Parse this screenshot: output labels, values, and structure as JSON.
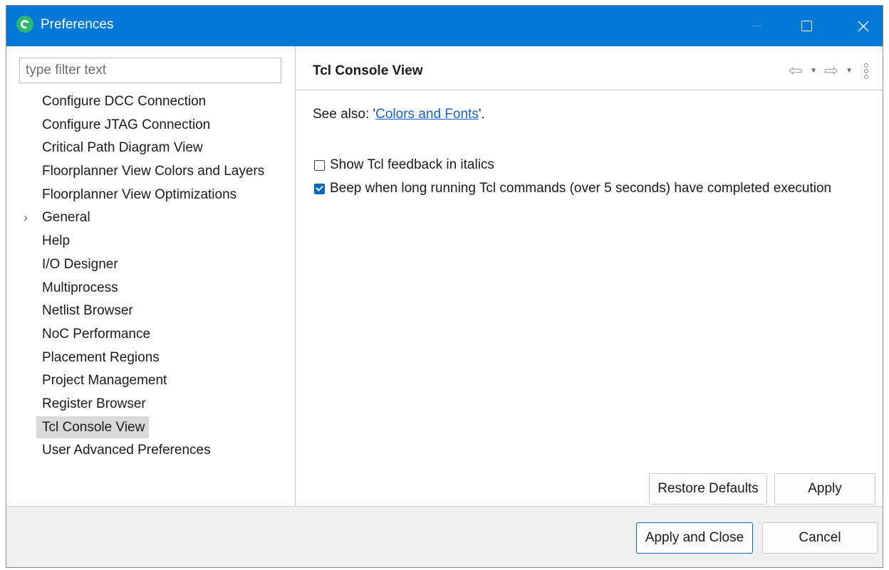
{
  "window": {
    "title": "Preferences"
  },
  "filter": {
    "placeholder": "type filter text"
  },
  "tree": {
    "items": [
      {
        "label": "Configure DCC Connection"
      },
      {
        "label": "Configure JTAG Connection"
      },
      {
        "label": "Critical Path Diagram View"
      },
      {
        "label": "Floorplanner View Colors and Layers"
      },
      {
        "label": "Floorplanner View Optimizations"
      },
      {
        "label": "General",
        "expandable": true
      },
      {
        "label": "Help"
      },
      {
        "label": "I/O Designer"
      },
      {
        "label": "Multiprocess"
      },
      {
        "label": "Netlist Browser"
      },
      {
        "label": "NoC Performance"
      },
      {
        "label": "Placement Regions"
      },
      {
        "label": "Project Management"
      },
      {
        "label": "Register Browser"
      },
      {
        "label": "Tcl Console View",
        "selected": true
      },
      {
        "label": "User Advanced Preferences"
      }
    ]
  },
  "page": {
    "title": "Tcl Console View",
    "see_also_prefix": "See also: '",
    "see_also_link": "Colors and Fonts",
    "see_also_suffix": "'.",
    "options": [
      {
        "label": "Show Tcl feedback in italics",
        "checked": false
      },
      {
        "label": "Beep when long running Tcl commands (over 5 seconds) have completed execution",
        "checked": true
      }
    ],
    "restore_defaults_label": "Restore Defaults",
    "apply_label": "Apply"
  },
  "footer": {
    "apply_close_label": "Apply and Close",
    "cancel_label": "Cancel"
  },
  "colors": {
    "titlebar": "#0078d4",
    "link": "#1a5fd0",
    "checkbox_checked": "#0067c0"
  },
  "icons": {
    "back": "back-arrow-icon",
    "forward": "forward-arrow-icon",
    "menu": "view-menu-icon",
    "app": "app-icon"
  }
}
